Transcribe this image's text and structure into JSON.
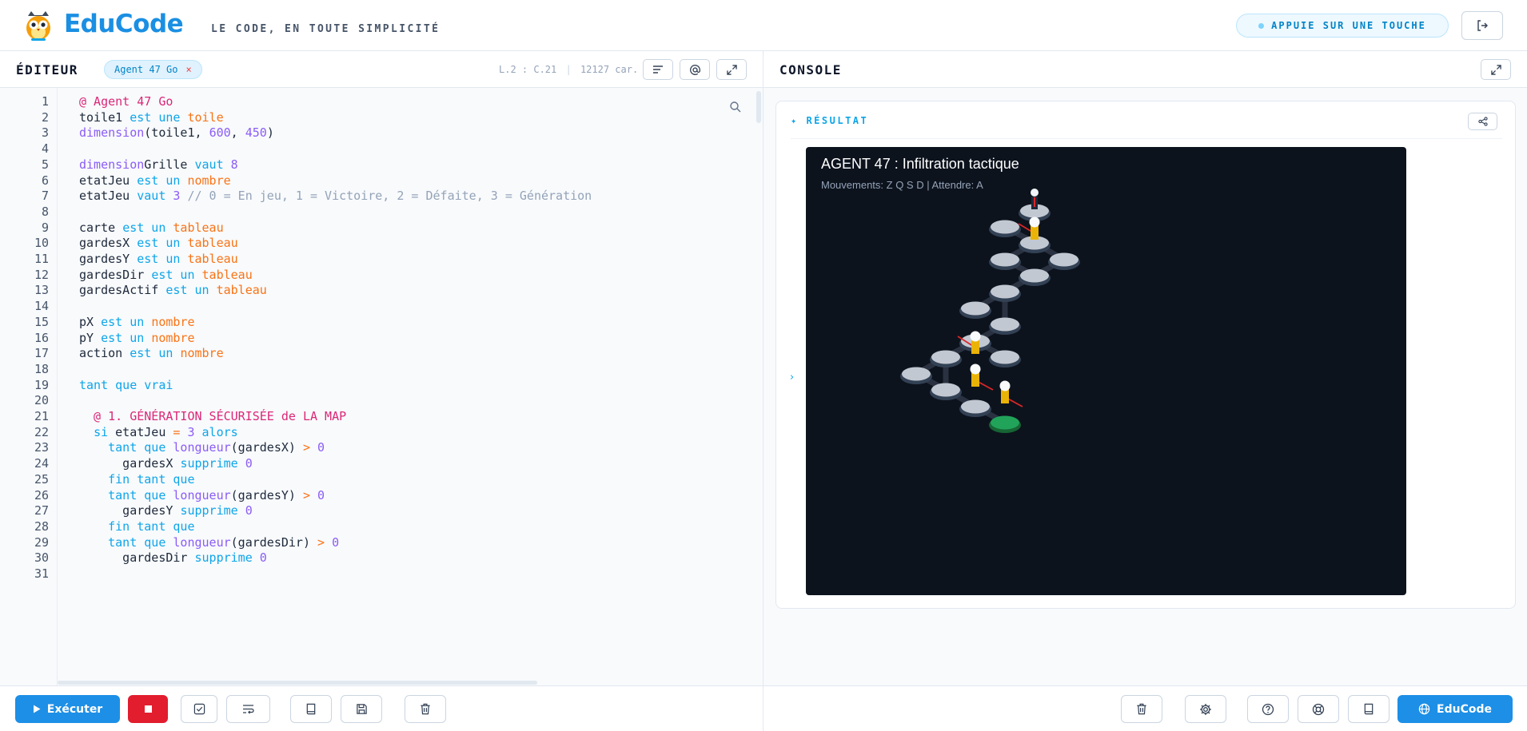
{
  "header": {
    "logo_text": "EduCode",
    "tagline": "LE CODE, EN TOUTE SIMPLICITÉ",
    "key_badge": "APPUIE SUR UNE TOUCHE",
    "logout_icon": "logout-icon"
  },
  "editor": {
    "title": "ÉDITEUR",
    "tab_label": "Agent 47 Go",
    "tab_close": "×",
    "cursor": "L.2 : C.21",
    "chars": "12127 car.",
    "separator": "|",
    "toolbar_icons": [
      "format-icon",
      "at-icon",
      "expand-icon"
    ],
    "lines": [
      {
        "n": "1",
        "code": "@ Agent 47 Go"
      },
      {
        "n": "2",
        "code": "toile1 est une toile"
      },
      {
        "n": "3",
        "code": "dimension(toile1, 600, 450)"
      },
      {
        "n": "4",
        "code": ""
      },
      {
        "n": "5",
        "code": "dimensionGrille vaut 8"
      },
      {
        "n": "6",
        "code": "etatJeu est un nombre"
      },
      {
        "n": "7",
        "code": "etatJeu vaut 3 // 0 = En jeu, 1 = Victoire, 2 = Défaite, 3 = Génération"
      },
      {
        "n": "8",
        "code": ""
      },
      {
        "n": "9",
        "code": "carte est un tableau"
      },
      {
        "n": "10",
        "code": "gardesX est un tableau"
      },
      {
        "n": "11",
        "code": "gardesY est un tableau"
      },
      {
        "n": "12",
        "code": "gardesDir est un tableau"
      },
      {
        "n": "13",
        "code": "gardesActif est un tableau"
      },
      {
        "n": "14",
        "code": ""
      },
      {
        "n": "15",
        "code": "pX est un nombre"
      },
      {
        "n": "16",
        "code": "pY est un nombre"
      },
      {
        "n": "17",
        "code": "action est un nombre"
      },
      {
        "n": "18",
        "code": ""
      },
      {
        "n": "19",
        "code": "tant que vrai"
      },
      {
        "n": "20",
        "code": ""
      },
      {
        "n": "21",
        "code": "  @ 1. GÉNÉRATION SÉCURISÉE de LA MAP"
      },
      {
        "n": "22",
        "code": "  si etatJeu = 3 alors"
      },
      {
        "n": "23",
        "code": "    tant que longueur(gardesX) > 0"
      },
      {
        "n": "24",
        "code": "      gardesX supprime 0"
      },
      {
        "n": "25",
        "code": "    fin tant que"
      },
      {
        "n": "26",
        "code": "    tant que longueur(gardesY) > 0"
      },
      {
        "n": "27",
        "code": "      gardesY supprime 0"
      },
      {
        "n": "28",
        "code": "    fin tant que"
      },
      {
        "n": "29",
        "code": "    tant que longueur(gardesDir) > 0"
      },
      {
        "n": "30",
        "code": "      gardesDir supprime 0"
      },
      {
        "n": "31",
        "code": ""
      }
    ]
  },
  "editor_footer": {
    "run_label": "Exécuter",
    "icons": [
      "play-icon",
      "stop-icon",
      "check-icon",
      "wrap-icon",
      "book-icon",
      "save-icon",
      "trash-icon"
    ]
  },
  "console": {
    "title": "CONSOLE",
    "result_label": "✦ RÉSULTAT",
    "chevron": "›",
    "game": {
      "title": "AGENT 47 : Infiltration tactique",
      "subtitle": "Mouvements: Z Q S D | Attendre: A"
    }
  },
  "console_footer": {
    "edu_label": "EduCode",
    "icons": [
      "trash-icon",
      "settings-icon",
      "help-icon",
      "lifebuoy-icon",
      "book-icon",
      "globe-icon"
    ]
  },
  "colors": {
    "accent": "#1d8fe6",
    "stop": "#e11d2e",
    "game_bg": "#0d131d",
    "exit_tile": "#22a35a",
    "guard": "#eab308"
  }
}
